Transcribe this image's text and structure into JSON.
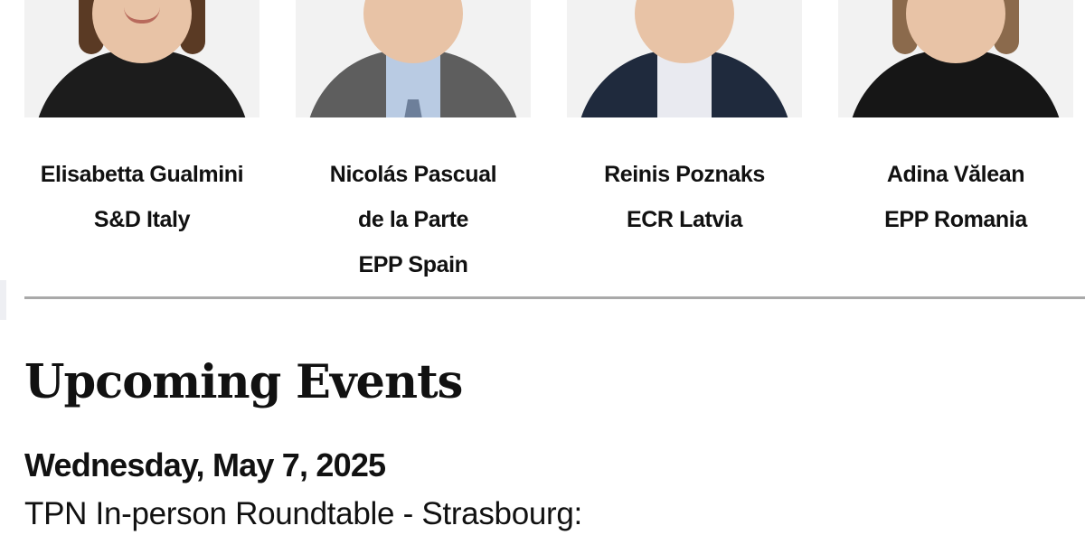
{
  "members": [
    {
      "name_lines": [
        "Elisabetta Gualmini",
        "S&D Italy"
      ],
      "photo": "portrait-woman-dark-hair-black-top",
      "colors": {
        "background": "#f2f2f2",
        "hair": "#5a3a24",
        "jacket": "#1c1c1c",
        "shirt": "#1c1c1c"
      }
    },
    {
      "name_lines": [
        "Nicolás Pascual",
        "de la Parte",
        "EPP Spain"
      ],
      "photo": "portrait-man-grey-suit-tie",
      "colors": {
        "background": "#f2f2f2",
        "hair": "#e6e6e6",
        "jacket": "#5e5e5e",
        "shirt": "#b9cbe3"
      }
    },
    {
      "name_lines": [
        "Reinis Poznaks",
        "ECR Latvia"
      ],
      "photo": "portrait-man-beard-navy-jacket",
      "colors": {
        "background": "#f2f2f2",
        "hair": "#e6e6e6",
        "jacket": "#1f2a3d",
        "shirt": "#e9eaf0"
      }
    },
    {
      "name_lines": [
        "Adina Vălean",
        "EPP Romania"
      ],
      "photo": "portrait-woman-brown-hair-black-top",
      "colors": {
        "background": "#f2f2f2",
        "hair": "#8b6a4c",
        "jacket": "#161616",
        "shirt": "#161616"
      }
    }
  ],
  "section": {
    "title": "Upcoming Events"
  },
  "events": [
    {
      "date": "Wednesday, May 7, 2025",
      "title": "TPN In-person Roundtable - Strasbourg:"
    }
  ],
  "colors": {
    "text": "#111111",
    "divider": "#a9a9a9",
    "background": "#ffffff"
  }
}
